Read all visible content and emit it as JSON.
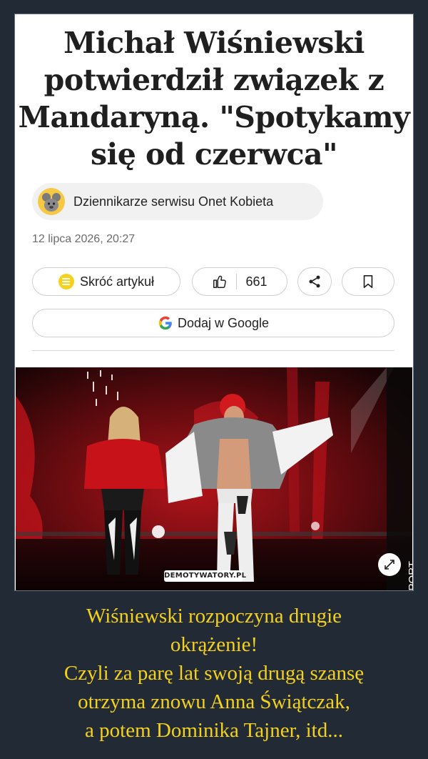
{
  "article": {
    "headline_lines": [
      "Michał Wiśniewski",
      "potwierdził związek z",
      "Mandaryną. \"Spotykamy",
      "się od czerwca\""
    ],
    "author": "Dziennikarze serwisu Onet Kobieta",
    "date": "12 lipca 2026, 20:27",
    "summary_label": "Skróć artykuł",
    "like_count": "661",
    "google_label": "Dodaj w Google"
  },
  "photo": {
    "credit": "Adrian Slazok/REPORT..."
  },
  "watermark": "DEMOTYWATORY.PL",
  "caption_lines": [
    "Wiśniewski rozpoczyna drugie",
    "okrążenie!",
    "Czyli za parę lat swoją drugą szansę",
    "otrzyma znowu Anna Świątczak,",
    "a potem Dominika Tajner, itd..."
  ],
  "colors": {
    "background": "#222a36",
    "caption": "#f4d21a",
    "summary_icon": "#f7d21d"
  }
}
